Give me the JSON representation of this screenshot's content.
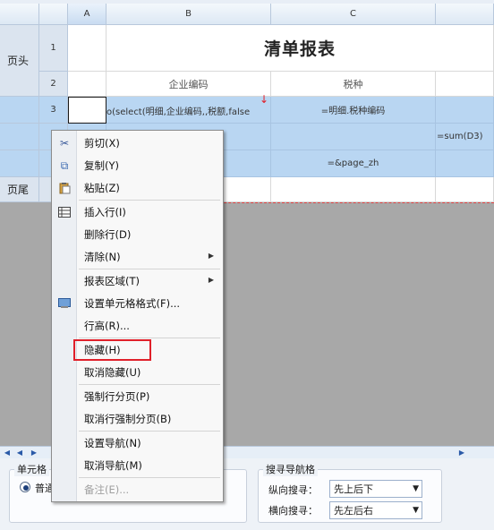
{
  "columns": [
    "A",
    "B",
    "C"
  ],
  "rows": {
    "r1": {
      "num": "1",
      "label": "页头",
      "title": "清单报表"
    },
    "r2": {
      "num": "2",
      "b": "企业编码",
      "c": "税种"
    },
    "r3": {
      "num": "3",
      "b": "o(select(明细,企业编码,,税额,false",
      "c": "=明细.税种编码"
    },
    "r4": {
      "d": "=sum(D3)"
    },
    "r5": {
      "c": "=&page_zh"
    },
    "r6": {
      "label": "页尾"
    }
  },
  "red_marker": "↓",
  "context_menu": {
    "items": [
      {
        "label": "剪切(X)",
        "icon": "cut-icon",
        "glyph": "✂"
      },
      {
        "label": "复制(Y)",
        "icon": "copy-icon",
        "glyph": "⧉"
      },
      {
        "label": "粘贴(Z)",
        "icon": "paste-icon",
        "glyph": "📋"
      },
      {
        "label": "插入行(I)",
        "icon": "insert-row-icon",
        "glyph": "☰"
      },
      {
        "label": "删除行(D)"
      },
      {
        "label": "清除(N)",
        "submenu": true
      },
      {
        "label": "报表区域(T)",
        "submenu": true
      },
      {
        "label": "设置单元格格式(F)...",
        "icon": "format-cell-icon",
        "glyph": "▦"
      },
      {
        "label": "行高(R)..."
      },
      {
        "label": "隐藏(H)",
        "highlighted": true
      },
      {
        "label": "取消隐藏(U)"
      },
      {
        "label": "强制行分页(P)"
      },
      {
        "label": "取消行强制分页(B)"
      },
      {
        "label": "设置导航(N)"
      },
      {
        "label": "取消导航(M)"
      },
      {
        "label": "备注(E)...",
        "disabled": true
      }
    ]
  },
  "cell_format_group": {
    "title": "单元格",
    "radio_label": "普通"
  },
  "drill_nav": {
    "title": "搜寻导航格",
    "vertical_label": "纵向搜寻：",
    "vertical_value": "先上后下",
    "horizontal_label": "横向搜寻：",
    "horizontal_value": "先左后右"
  },
  "colors": {
    "selection": "#b9d6f2",
    "highlight_box": "#e0202a"
  }
}
